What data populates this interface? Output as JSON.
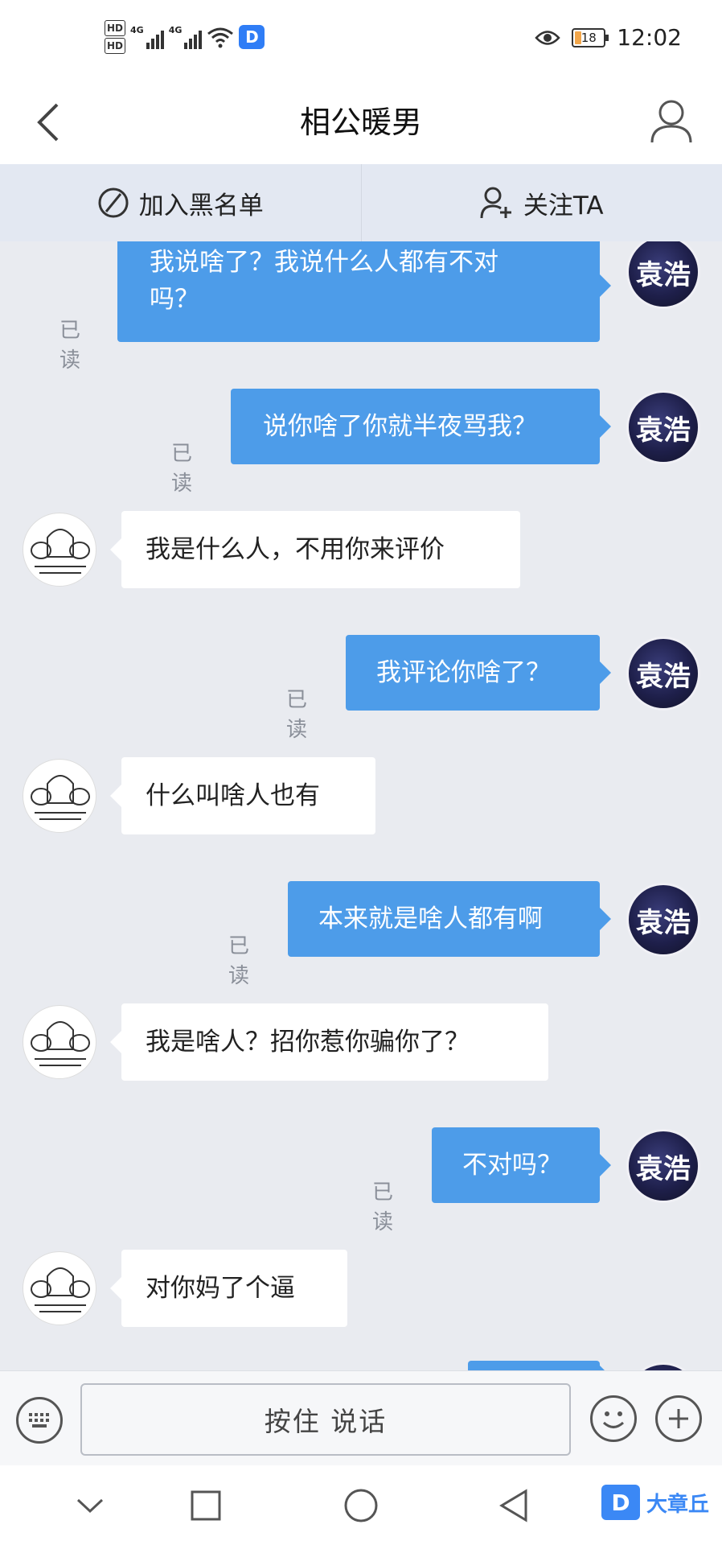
{
  "status_bar": {
    "hd1": "HD",
    "hd2": "HD",
    "net1": "4G",
    "net2": "4G",
    "app_badge": "D",
    "battery": "18",
    "time": "12:02"
  },
  "header": {
    "title": "相公暖男"
  },
  "actions": {
    "blacklist": "加入黑名单",
    "follow": "关注TA"
  },
  "messages": [
    {
      "side": "out",
      "lines": [
        "我说啥了？我说什么人都有不对",
        "吗？"
      ],
      "read": "已读"
    },
    {
      "side": "out",
      "lines": [
        "说你啥了你就半夜骂我？"
      ],
      "read": "已读"
    },
    {
      "side": "in",
      "lines": [
        "我是什么人，不用你来评价"
      ]
    },
    {
      "side": "out",
      "lines": [
        "我评论你啥了？"
      ],
      "read": "已读"
    },
    {
      "side": "in",
      "lines": [
        "什么叫啥人也有"
      ]
    },
    {
      "side": "out",
      "lines": [
        "本来就是啥人都有啊"
      ],
      "read": "已读"
    },
    {
      "side": "in",
      "lines": [
        "我是啥人？招你惹你骗你了？"
      ]
    },
    {
      "side": "out",
      "lines": [
        "不对吗？"
      ],
      "read": "已读"
    },
    {
      "side": "in",
      "lines": [
        "对你妈了个逼"
      ]
    }
  ],
  "input": {
    "talk_label": "按住  说话"
  },
  "watermark": {
    "logo": "D",
    "text": "大章丘"
  },
  "colors": {
    "outgoing_bubble": "#4d9ce9",
    "incoming_bubble": "#ffffff",
    "chat_bg": "#e9ebf0"
  }
}
